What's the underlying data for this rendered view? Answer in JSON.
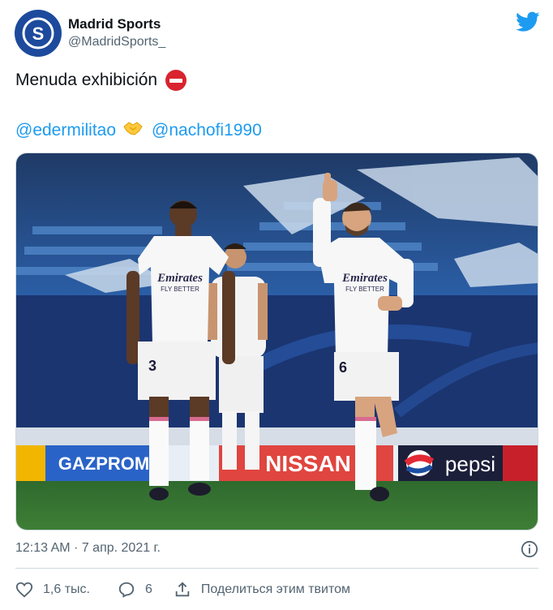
{
  "author": {
    "name": "Madrid Sports",
    "handle": "@MadridSports_",
    "avatar_letter": "S",
    "avatar_color": "#1d4a9c"
  },
  "brand_icon": "twitter-bird-icon",
  "brand_color": "#1d9bf0",
  "tweet": {
    "text": "Menuda exhibición",
    "text_emoji": "no-entry-icon",
    "mention_1": "@edermilitao",
    "handshake_emoji": "handshake-icon",
    "mention_2": "@nachofi1990"
  },
  "photo": {
    "shirt_sponsor_left": "Emirates",
    "shirt_sponsor_left_sub": "FLY BETTER",
    "shirt_sponsor_right": "Emirates",
    "shirt_sponsor_right_sub": "FLY BETTER",
    "number_left": "3",
    "number_right": "6",
    "board_1": "GAZPROM",
    "board_2": "NISSAN",
    "board_3": "pepsi"
  },
  "timestamp": "12:13 AM · 7 апр. 2021 г.",
  "actions": {
    "likes": "1,6 тыс.",
    "replies": "6",
    "share": "Поделиться этим твитом"
  }
}
